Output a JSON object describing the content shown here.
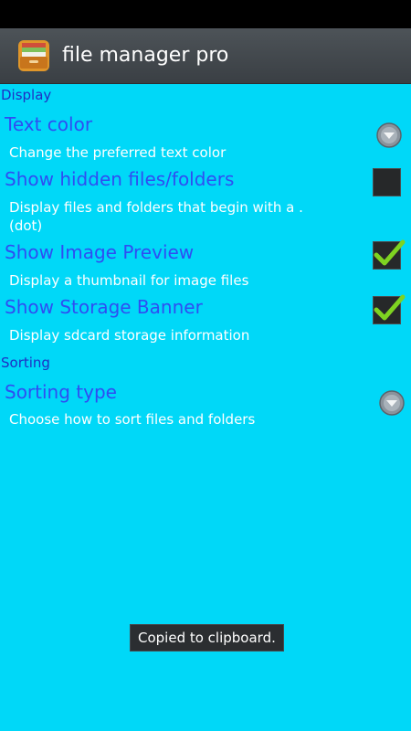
{
  "app": {
    "title": "file manager pro",
    "icon": "file-cabinet-icon"
  },
  "sections": {
    "display": {
      "header": "Display",
      "text_color": {
        "title": "Text color",
        "summary": "Change the preferred text color",
        "control": "dropdown-arrow-icon"
      },
      "hidden_files": {
        "title": "Show hidden files/folders",
        "summary": "Display files and folders that begin with a . (dot)",
        "checked": false
      },
      "image_preview": {
        "title": "Show Image Preview",
        "summary": "Display a thumbnail for image files",
        "checked": true
      },
      "storage_banner": {
        "title": "Show Storage Banner",
        "summary": "Display sdcard storage information",
        "checked": true
      }
    },
    "sorting": {
      "header": "Sorting",
      "sorting_type": {
        "title": "Sorting type",
        "summary": "Choose how to sort files and folders",
        "control": "dropdown-arrow-icon"
      }
    }
  },
  "toast": {
    "message": "Copied to clipboard."
  },
  "colors": {
    "background": "#00d8f8",
    "section_header": "#1f2fc4",
    "pref_title": "#2f4df2",
    "summary_text": "#ffffff",
    "checkmark": "#7ed321",
    "action_bar": "#3f4449"
  }
}
